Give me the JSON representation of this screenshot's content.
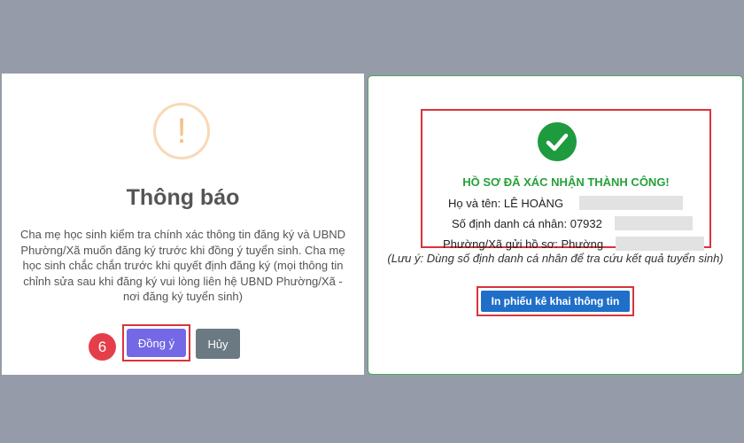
{
  "dialog": {
    "icon": "exclamation-icon",
    "icon_glyph": "!",
    "title": "Thông báo",
    "message": "Cha mẹ học sinh kiểm tra chính xác thông tin đăng ký và UBND Phường/Xã muốn đăng ký trước khi đồng ý tuyển sinh. Cha mẹ học sinh chắc chắn trước khi quyết định đăng ký (mọi thông tin chỉnh sửa sau khi đăng ký vui lòng liên hệ UBND Phường/Xã - nơi đăng ký tuyển sinh)",
    "step_number": "6",
    "confirm_label": "Đồng ý",
    "cancel_label": "Hủy"
  },
  "success": {
    "icon": "check-circle-icon",
    "title": "HỒ SƠ ĐÃ XÁC NHẬN THÀNH CÔNG!",
    "name_line": "Họ và tên: LÊ HOÀNG",
    "id_line": "Số định danh cá nhân: 07932",
    "ward_line": "Phường/Xã gửi hồ sơ: Phường",
    "note": "(Lưu ý: Dùng số định danh cá nhân để tra cứu kết quả tuyển sinh)",
    "print_label": "In phiếu kê khai thông tin"
  },
  "colors": {
    "background": "#959ba8",
    "warning": "#f6c08a",
    "confirm": "#7468e6",
    "cancel": "#6b7a82",
    "success": "#1e9a3f",
    "highlight": "#d9343c",
    "primary": "#1f6fc8"
  }
}
